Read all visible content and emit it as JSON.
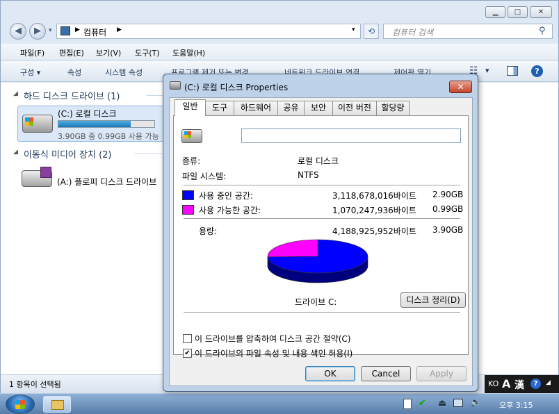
{
  "explorer": {
    "address": "컴퓨터",
    "search_placeholder": "컴퓨터 검색",
    "menu": [
      "파일(F)",
      "편집(E)",
      "보기(V)",
      "도구(T)",
      "도움말(H)"
    ],
    "toolbar": [
      "구성 ▾",
      "속성",
      "시스템 속성",
      "프로그램 제거 또는 변경",
      "네트워크 드라이브 연결",
      "제어판 열기"
    ],
    "group_hdd": "하드 디스크 드라이브 (1)",
    "drive_c_name": "(C:) 로컬 디스크",
    "drive_c_space": "3.90GB 중 0.99GB 사용 가능",
    "drive_c_fill": 0.75,
    "group_removable": "이동식 미디어 장치 (2)",
    "drive_a_name": "(A:) 플로피 디스크 드라이브",
    "status": "1 항목이 선택됨"
  },
  "dialog": {
    "title": "(C:) 로컬 디스크 Properties",
    "close": "✕",
    "tabs": [
      "일반",
      "도구",
      "하드웨어",
      "공유",
      "보안",
      "이전 버전",
      "할당량"
    ],
    "name_value": "",
    "type_label": "종류:",
    "type_value": "로컬 디스크",
    "fs_label": "파일 시스템:",
    "fs_value": "NTFS",
    "used_label": "사용 중인 공간:",
    "used_bytes": "3,118,678,016바이트",
    "used_gb": "2.90GB",
    "free_label": "사용 가능한 공간:",
    "free_bytes": "1,070,247,936바이트",
    "free_gb": "0.99GB",
    "cap_label": "용량:",
    "cap_bytes": "4,188,925,952바이트",
    "cap_gb": "3.90GB",
    "drive_label": "드라이브 C:",
    "cleanup": "디스크 정리(D)",
    "compress": "이 드라이브를 압축하여 디스크 공간 절약(C)",
    "index": "이 드라이브의 파일 속성 및 내용 색인 허용(I)",
    "compress_checked": false,
    "index_checked": true,
    "ok": "OK",
    "cancel": "Cancel",
    "apply": "Apply",
    "colors": {
      "used": "#0000ff",
      "free": "#ff00ff"
    }
  },
  "taskbar": {
    "lang": "KO",
    "ime_a": "A",
    "ime_han": "漢",
    "clock": "오후 3:15"
  }
}
